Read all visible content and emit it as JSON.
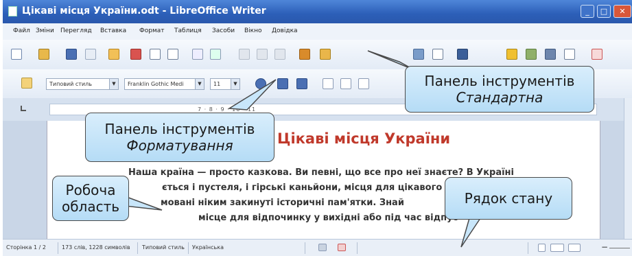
{
  "window": {
    "title": "Цікаві місця України.odt - LibreOffice Writer",
    "buttons": {
      "minimize": "_",
      "maximize": "□",
      "close": "✕"
    }
  },
  "menu": {
    "items": [
      "Файл",
      "Зміни",
      "Перегляд",
      "Вставка",
      "Формат",
      "Таблиця",
      "Засоби",
      "Вікно",
      "Довідка"
    ]
  },
  "formatting_toolbar": {
    "style_value": "Типовий стиль",
    "font_value": "Franklin Gothic Medi",
    "size_value": "11"
  },
  "ruler": {
    "numbers": "7 · 8 · 9 · 10 · 11"
  },
  "document": {
    "title": "Цікаві місця України",
    "lines": [
      "Наша країна — просто казкова. Ви певні, що все про неї знаєте? В Україні",
      "ється і пустеля, і гірські каньйони, місця для цікавого",
      "мовані ніким закинуті історичні пам'ятки. Знай",
      "місце для відпочинку у вихідні або під час відпус"
    ]
  },
  "statusbar": {
    "page": "Сторінка 1 / 2",
    "words": "173 слів, 1228 символів",
    "style": "Типовий стиль",
    "language": "Українська"
  },
  "callouts": {
    "standard_toolbar": {
      "line1": "Панель інструментів",
      "line2": "Стандартна"
    },
    "formatting_toolbar": {
      "line1": "Панель інструментів",
      "line2": "Форматування"
    },
    "work_area": {
      "line1": "Робоча",
      "line2": "область"
    },
    "status_bar": {
      "line1": "Рядок стану"
    }
  },
  "colors": {
    "title_bar": "#2c5fb8",
    "callout_fill": "#c8e6fa",
    "document_title": "#c0392b"
  }
}
